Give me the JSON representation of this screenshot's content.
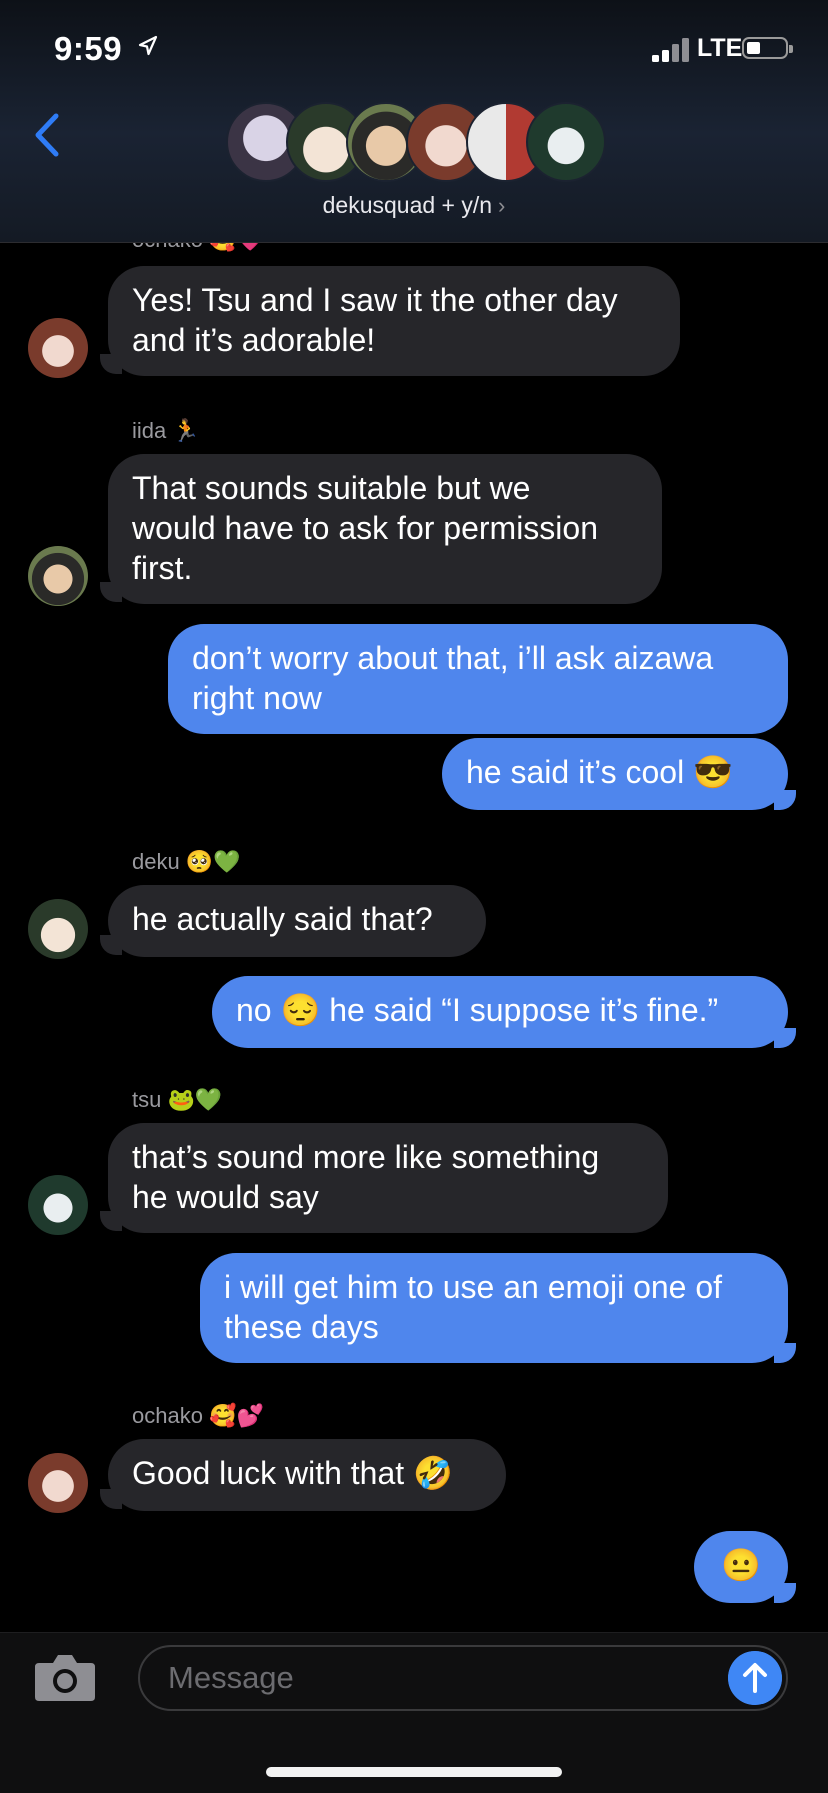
{
  "status": {
    "time": "9:59",
    "network": "LTE"
  },
  "header": {
    "group_name": "dekusquad + y/n",
    "chevron": "›",
    "avatar_count": 6
  },
  "messages": [
    {
      "dir": "in",
      "sender": "ochako 🥰💗",
      "lines": [
        "Yes! Tsu and I saw it the other day",
        "and it’s adorable!"
      ]
    },
    {
      "dir": "in",
      "sender": "iida 🏃",
      "lines": [
        "That sounds suitable but we",
        "would have to ask for permission",
        "first."
      ]
    },
    {
      "dir": "out",
      "lines": [
        "don’t worry about that, i’ll ask aizawa",
        "right now"
      ]
    },
    {
      "dir": "out",
      "lines": [
        "he said it’s cool 😎"
      ]
    },
    {
      "dir": "in",
      "sender": "deku 🥺💚",
      "lines": [
        "he actually said that?"
      ]
    },
    {
      "dir": "out",
      "lines": [
        "no 😔 he said “I suppose it’s fine.”"
      ]
    },
    {
      "dir": "in",
      "sender": "tsu 🐸💚",
      "lines": [
        "that’s sound more like something",
        "he would say"
      ]
    },
    {
      "dir": "out",
      "lines": [
        "i will get him to use an emoji one of",
        "these days"
      ]
    },
    {
      "dir": "in",
      "sender": "ochako 🥰💕",
      "lines": [
        "Good luck with that 🤣"
      ]
    },
    {
      "dir": "out",
      "lines": [
        "😐"
      ]
    }
  ],
  "composer": {
    "placeholder": "Message"
  },
  "colors": {
    "outgoing": "#4f86ed",
    "incoming": "#26262a",
    "accent": "#3f87f5"
  },
  "icons": [
    "location-arrow-icon",
    "signal-icon",
    "battery-icon",
    "back-chevron-icon",
    "camera-icon",
    "send-arrow-icon"
  ]
}
